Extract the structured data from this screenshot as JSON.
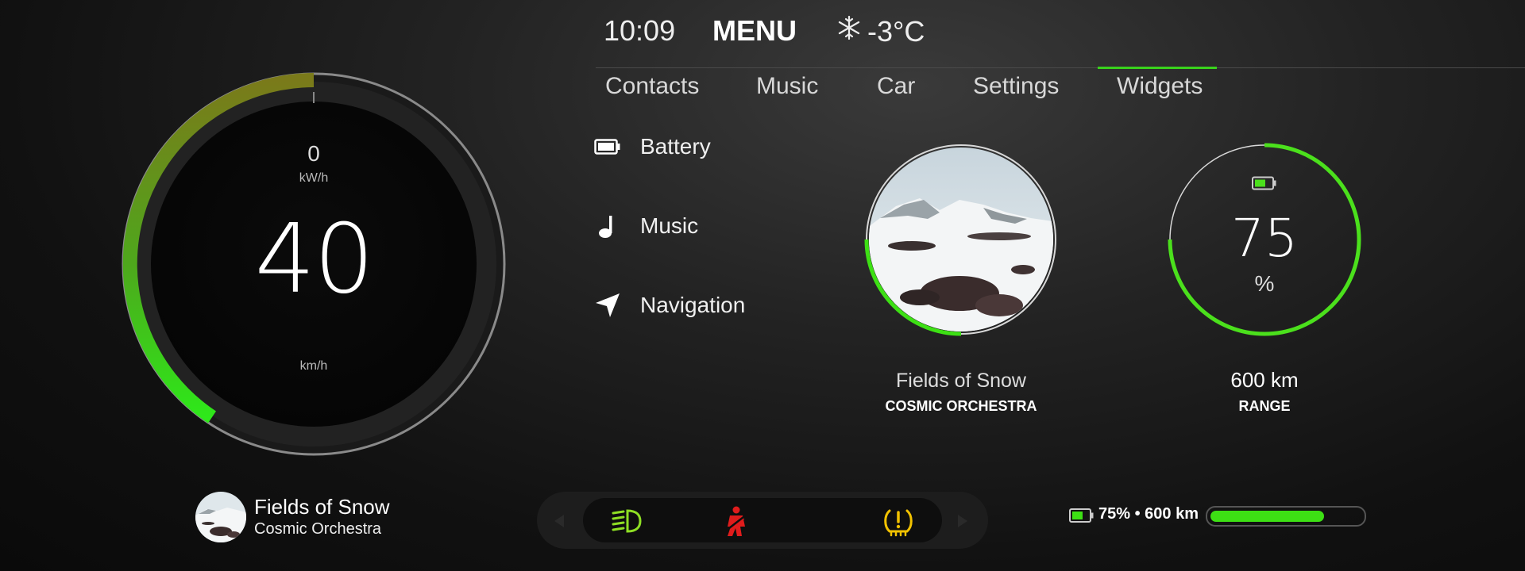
{
  "header": {
    "time": "10:09",
    "menu_label": "MENU",
    "temperature": "-3°C",
    "temp_icon": "snowflake-icon"
  },
  "tabs": [
    {
      "label": "Contacts",
      "active": false
    },
    {
      "label": "Music",
      "active": false
    },
    {
      "label": "Car",
      "active": false
    },
    {
      "label": "Settings",
      "active": false
    },
    {
      "label": "Widgets",
      "active": true
    }
  ],
  "menu": [
    {
      "label": "Battery",
      "icon": "battery-icon"
    },
    {
      "label": "Music",
      "icon": "music-note-icon"
    },
    {
      "label": "Navigation",
      "icon": "navigation-arrow-icon"
    }
  ],
  "gauge": {
    "power_value": "0",
    "power_unit": "kW/h",
    "speed": "40",
    "speed_unit": "km/h",
    "colors": {
      "start": "#7a7a1a",
      "end": "#2ee81a"
    }
  },
  "album_widget": {
    "title": "Fields of Snow",
    "artist": "COSMIC ORCHESTRA",
    "progress_fraction": 0.25,
    "accent": "#3de014"
  },
  "battery_widget": {
    "percent": "75",
    "unit": "%",
    "level_fraction": 0.75,
    "range": "600 km",
    "range_label": "RANGE",
    "accent": "#4be01c"
  },
  "now_playing": {
    "title": "Fields of Snow",
    "artist": "Cosmic Orchestra"
  },
  "warnings": [
    {
      "icon": "headlight-icon",
      "color": "#8fe024"
    },
    {
      "icon": "seatbelt-icon",
      "color": "#e01c1c"
    },
    {
      "icon": "tire-pressure-icon",
      "color": "#f2c200"
    }
  ],
  "battery_status": {
    "text": "75% • 600 km",
    "level_fraction": 0.75,
    "color": "#3de014"
  }
}
